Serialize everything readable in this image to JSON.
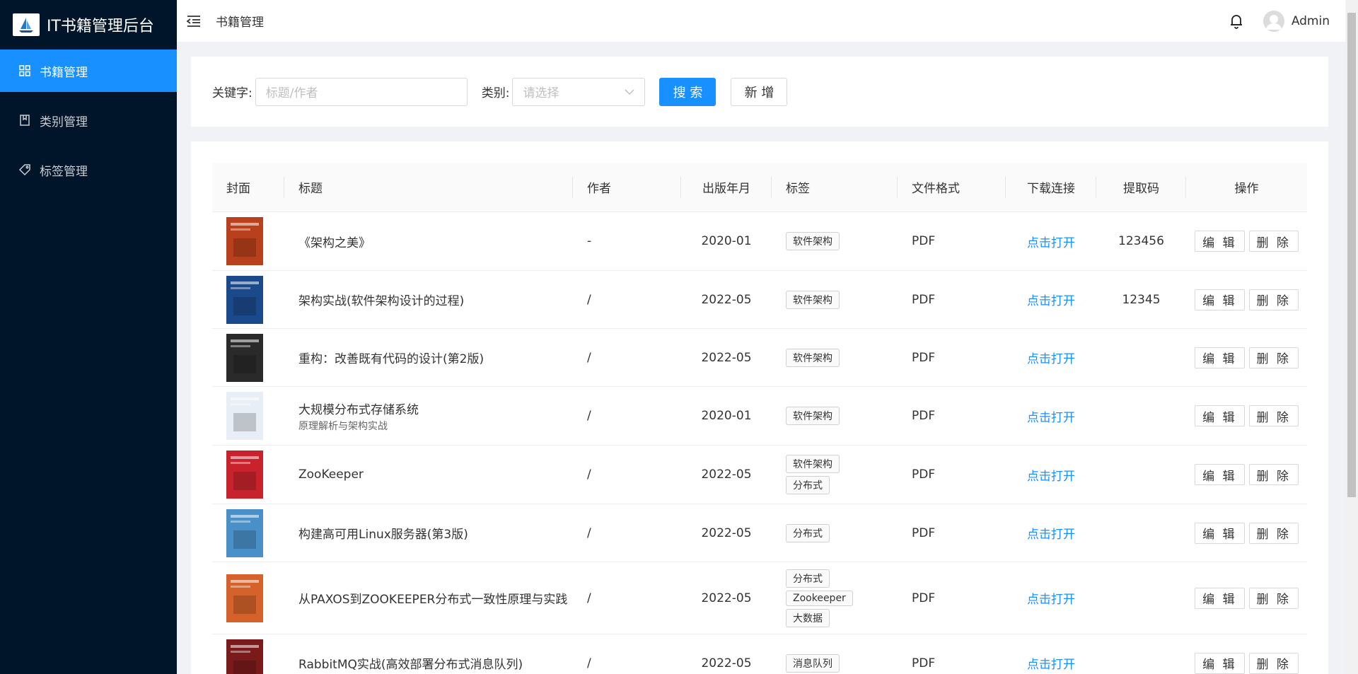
{
  "app": {
    "title": "IT书籍管理后台"
  },
  "sidebar": {
    "items": [
      {
        "label": "书籍管理",
        "icon": "dashboard-icon",
        "active": true
      },
      {
        "label": "类别管理",
        "icon": "book-icon",
        "active": false
      },
      {
        "label": "标签管理",
        "icon": "tag-icon",
        "active": false
      }
    ]
  },
  "header": {
    "page_title": "书籍管理",
    "user_name": "Admin"
  },
  "search": {
    "keyword_label": "关键字:",
    "keyword_placeholder": "标题/作者",
    "category_label": "类别:",
    "category_placeholder": "请选择",
    "search_button": "搜 索",
    "add_button": "新 增"
  },
  "table": {
    "columns": [
      "封面",
      "标题",
      "作者",
      "出版年月",
      "标签",
      "文件格式",
      "下载连接",
      "提取码",
      "操作"
    ],
    "edit_label": "编 辑",
    "delete_label": "删 除",
    "rows": [
      {
        "title": "《架构之美》",
        "subtitle": "",
        "author": "-",
        "date": "2020-01",
        "tags": [
          "软件架构"
        ],
        "format": "PDF",
        "link": "点击打开",
        "code": "123456",
        "cover_color": "#b8401c"
      },
      {
        "title": "架构实战(软件架构设计的过程)",
        "subtitle": "",
        "author": "/",
        "date": "2022-05",
        "tags": [
          "软件架构"
        ],
        "format": "PDF",
        "link": "点击打开",
        "code": "12345",
        "cover_color": "#1b4a8c"
      },
      {
        "title": "重构：改善既有代码的设计(第2版)",
        "subtitle": "",
        "author": "/",
        "date": "2022-05",
        "tags": [
          "软件架构"
        ],
        "format": "PDF",
        "link": "点击打开",
        "code": "",
        "cover_color": "#2a2a2a"
      },
      {
        "title": "大规模分布式存储系统",
        "subtitle": "原理解析与架构实战",
        "author": "/",
        "date": "2020-01",
        "tags": [
          "软件架构"
        ],
        "format": "PDF",
        "link": "点击打开",
        "code": "",
        "cover_color": "#e8eef6"
      },
      {
        "title": "ZooKeeper",
        "subtitle": "",
        "author": "/",
        "date": "2022-05",
        "tags": [
          "软件架构",
          "分布式"
        ],
        "format": "PDF",
        "link": "点击打开",
        "code": "",
        "cover_color": "#c8232c"
      },
      {
        "title": "构建高可用Linux服务器(第3版)",
        "subtitle": "",
        "author": "/",
        "date": "2022-05",
        "tags": [
          "分布式"
        ],
        "format": "PDF",
        "link": "点击打开",
        "code": "",
        "cover_color": "#4a90c8"
      },
      {
        "title": "从PAXOS到ZOOKEEPER分布式一致性原理与实践",
        "subtitle": "",
        "author": "/",
        "date": "2022-05",
        "tags": [
          "分布式",
          "Zookeeper",
          "大数据"
        ],
        "format": "PDF",
        "link": "点击打开",
        "code": "",
        "cover_color": "#d4622a"
      },
      {
        "title": "RabbitMQ实战(高效部署分布式消息队列)",
        "subtitle": "",
        "author": "/",
        "date": "2022-05",
        "tags": [
          "消息队列"
        ],
        "format": "PDF",
        "link": "点击打开",
        "code": "",
        "cover_color": "#7a1a1a"
      }
    ]
  },
  "colors": {
    "sidebar_bg": "#001529",
    "accent": "#1890ff",
    "page_bg": "#f0f2f5"
  }
}
